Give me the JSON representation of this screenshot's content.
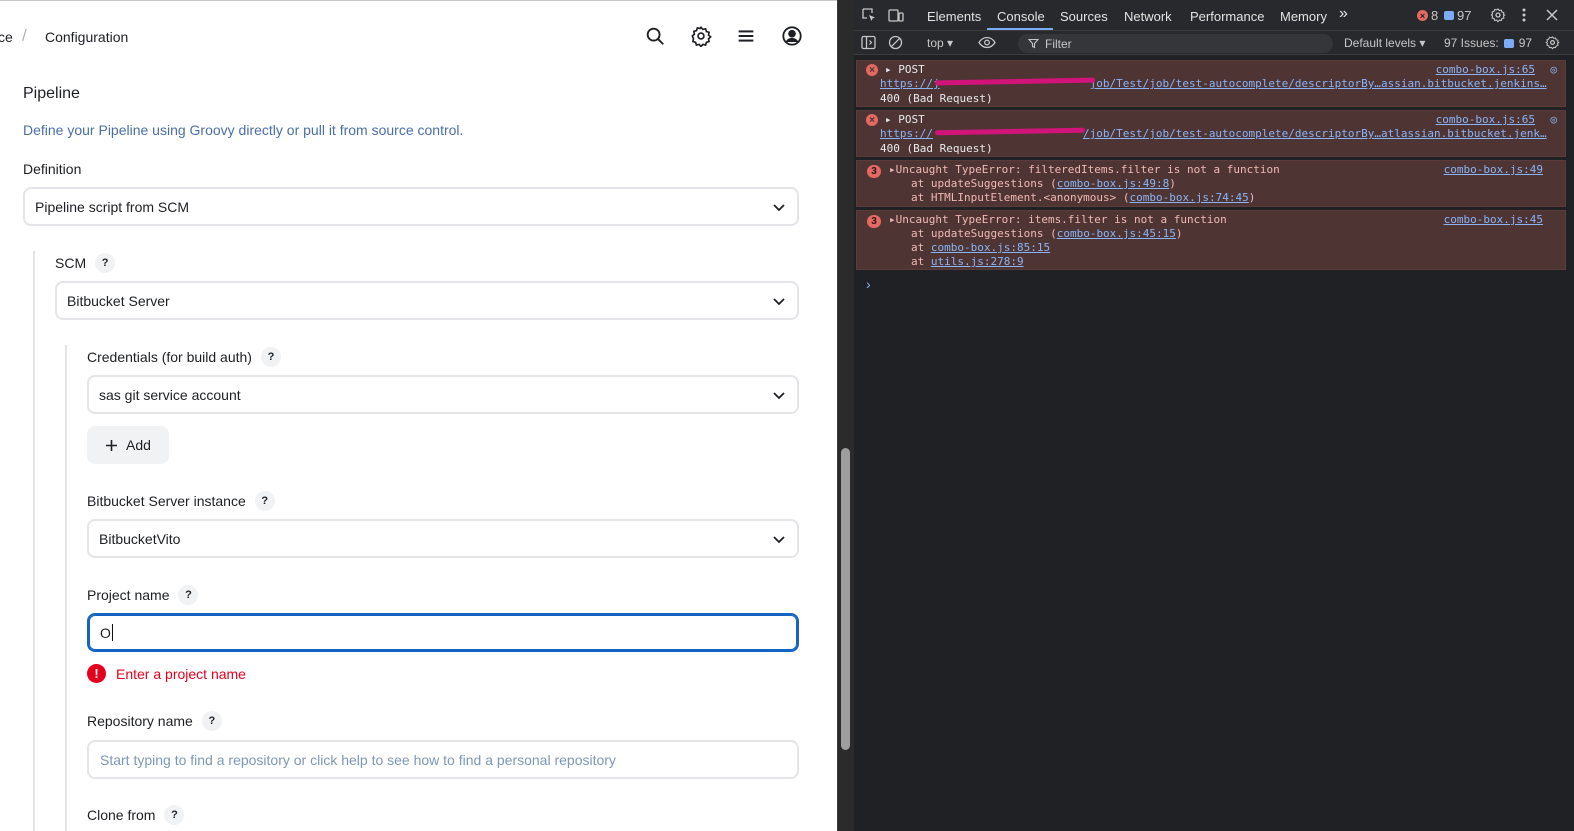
{
  "jenkins": {
    "breadcrumb": {
      "prev": "ce",
      "separator": "/",
      "current": "Configuration"
    },
    "topbar_icons": [
      "search-icon",
      "gear-icon",
      "menu-icon",
      "user-icon"
    ],
    "pipeline": {
      "title": "Pipeline",
      "description": "Define your Pipeline using Groovy directly or pull it from source control.",
      "definition_label": "Definition",
      "definition_value": "Pipeline script from SCM"
    },
    "scm": {
      "label": "SCM",
      "help": "?",
      "value": "Bitbucket Server",
      "credentials_label": "Credentials (for build auth)",
      "credentials_value": "sas git service account",
      "add_label": "Add",
      "instance_label": "Bitbucket Server instance",
      "instance_value": "BitbucketVito",
      "project_label": "Project name",
      "project_value": "O",
      "project_error": "Enter a project name",
      "error_icon": "!",
      "repo_label": "Repository name",
      "repo_placeholder": "Start typing to find a repository or click help to see how to find a personal repository",
      "clone_label": "Clone from"
    }
  },
  "devtools": {
    "tabs": [
      "Elements",
      "Console",
      "Sources",
      "Network",
      "Performance",
      "Memory"
    ],
    "active_tab": "Console",
    "more_tabs": "»",
    "error_count": "8",
    "issue_count": "97",
    "context": "top ▾",
    "filter_placeholder": "Filter",
    "levels": "Default levels ▾",
    "issues_label": "97 Issues:",
    "issues_count": "97",
    "logs": [
      {
        "method": "▸ POST",
        "url_pre": "https://j",
        "url_post": "job/Test/job/test-autocomplete/descriptorBy…assian.bitbucket.jenkins…",
        "status": "400 (Bad Request)",
        "source": "combo-box.js:65"
      },
      {
        "method": "▸ POST",
        "url_pre": "https://",
        "url_post": "/job/Test/job/test-autocomplete/descriptorBy…atlassian.bitbucket.jenk…",
        "status": "400 (Bad Request)",
        "source": "combo-box.js:65"
      }
    ],
    "errors": [
      {
        "count": "3",
        "message": "▸Uncaught TypeError: filteredItems.filter is not a function",
        "source": "combo-box.js:49",
        "stack1_pre": "at updateSuggestions (",
        "stack1_link": "combo-box.js:49:8",
        "stack1_post": ")",
        "stack2_pre": "at HTMLInputElement.<anonymous> (",
        "stack2_link": "combo-box.js:74:45",
        "stack2_post": ")"
      },
      {
        "count": "3",
        "message": "▸Uncaught TypeError: items.filter is not a function",
        "source": "combo-box.js:45",
        "stack1_pre": "at updateSuggestions (",
        "stack1_link": "combo-box.js:45:15",
        "stack1_post": ")",
        "stack2_pre": "at ",
        "stack2_link": "combo-box.js:85:15",
        "stack3_pre": "at ",
        "stack3_link": "utils.js:278:9"
      }
    ],
    "prompt": "›"
  },
  "colors": {
    "accent": "#1565c0",
    "error": "#e6001e",
    "devtools_bg": "#202124",
    "log_error_bg": "#4e3534"
  }
}
